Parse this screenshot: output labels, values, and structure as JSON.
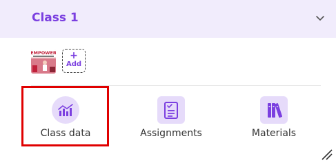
{
  "class_panel": {
    "title": "Class 1",
    "cover_thumbnail_text": "EMPOWER",
    "add_button": {
      "icon": "+",
      "label": "Add"
    }
  },
  "tiles": [
    {
      "label": "Class data",
      "icon": "bar-chart-icon"
    },
    {
      "label": "Assignments",
      "icon": "clipboard-list-icon"
    },
    {
      "label": "Materials",
      "icon": "books-icon"
    }
  ],
  "colors": {
    "accent": "#7b3fe0",
    "header_background": "#f1ecfc",
    "icon_background": "#e6dbfa",
    "highlight": "#e00000"
  }
}
